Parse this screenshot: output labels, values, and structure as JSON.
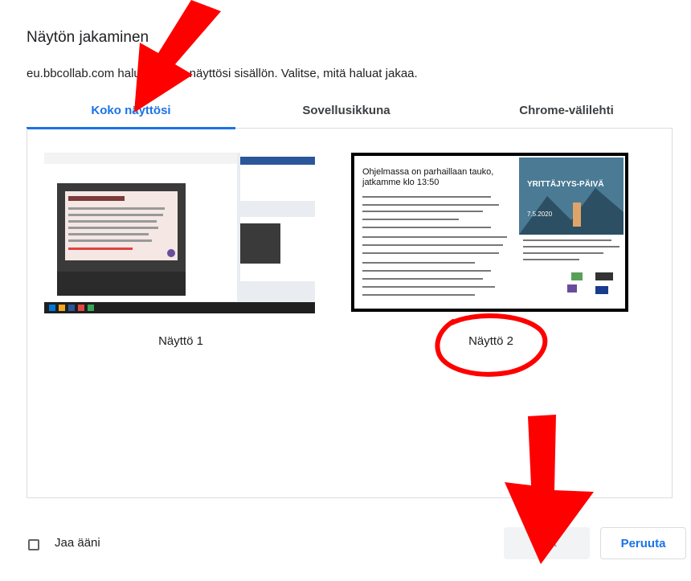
{
  "dialog": {
    "title": "Näytön jakaminen",
    "subtitle": "eu.bbcollab.com haluaa jakaa näyttösi sisällön. Valitse, mitä haluat jakaa."
  },
  "tabs": [
    {
      "label": "Koko näyttösi",
      "active": true
    },
    {
      "label": "Sovellusikkuna",
      "active": false
    },
    {
      "label": "Chrome-välilehti",
      "active": false
    }
  ],
  "screens": [
    {
      "label": "Näyttö 1"
    },
    {
      "label": "Näyttö 2"
    }
  ],
  "screen2_preview": {
    "heading": "Ohjelmassa on parhaillaan tauko, jatkamme klo 13:50",
    "event_title": "YRITTÄJYYS-PÄIVÄ",
    "event_date": "7.5.2020"
  },
  "share_audio": {
    "label": "Jaa ääni",
    "checked": false
  },
  "buttons": {
    "share": "Jaa",
    "cancel": "Peruuta"
  },
  "colors": {
    "accent": "#1a73e8",
    "annotation": "#ff0000"
  }
}
